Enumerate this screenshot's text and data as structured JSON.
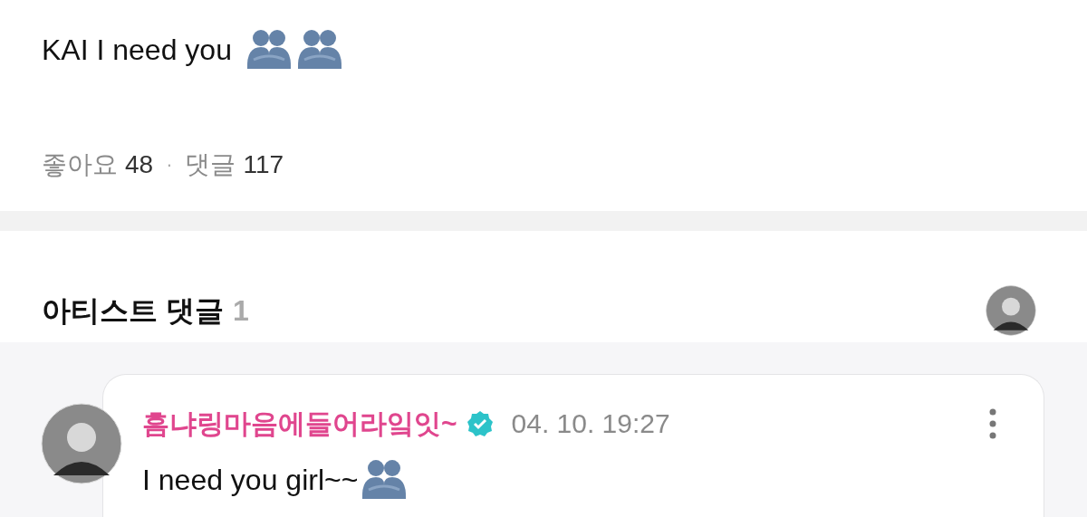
{
  "post": {
    "text": "KAI I need you",
    "emojis": [
      {
        "kind": "hug"
      },
      {
        "kind": "hug"
      }
    ],
    "likes_label": "좋아요",
    "likes": "48",
    "separator": "·",
    "comments_label": "댓글",
    "comments": "117"
  },
  "artist_comments": {
    "title": "아티스트 댓글",
    "count": "1"
  },
  "comments": [
    {
      "author": "흠냐링마음에들어라잌잇~",
      "verified": true,
      "date": "04. 10. 19:27",
      "text": "I need you girl~~",
      "emojis": [
        {
          "kind": "hug"
        }
      ]
    }
  ]
}
